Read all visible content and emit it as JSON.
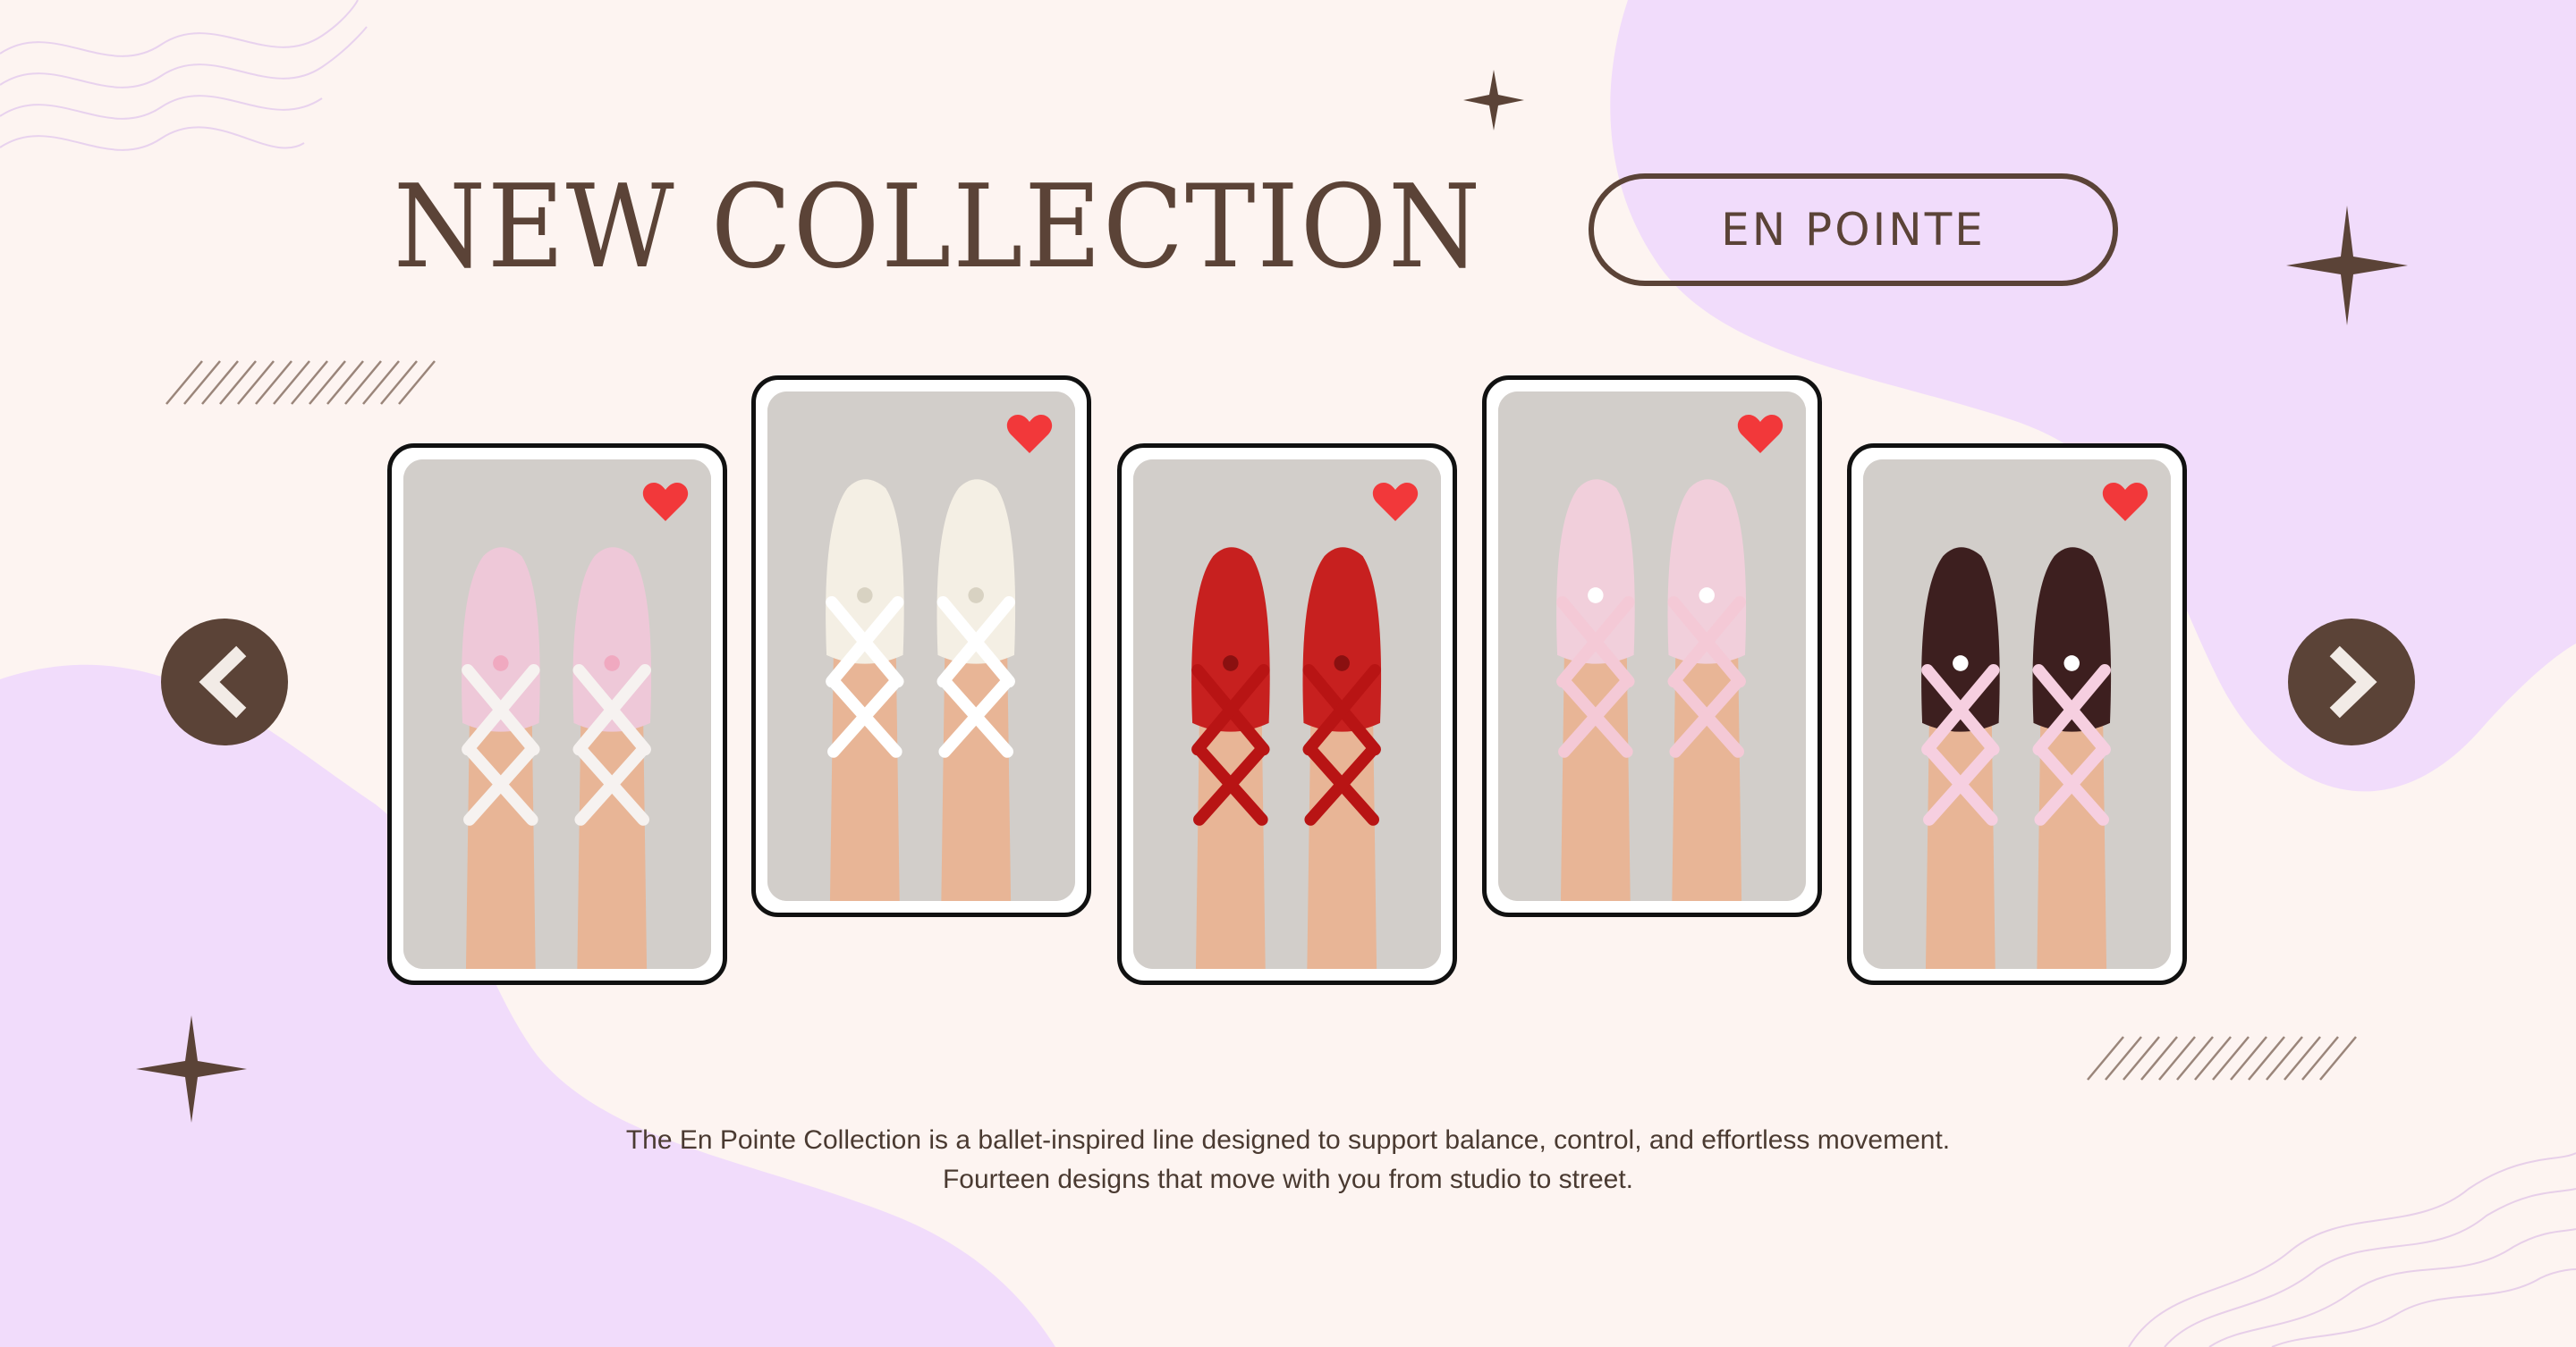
{
  "header": {
    "title": "NEW COLLECTION",
    "tag": "EN POINTE"
  },
  "carousel": {
    "prev_icon": "chevron-left-icon",
    "next_icon": "chevron-right-icon",
    "cards": [
      {
        "sock_color": "#eec8d8",
        "ribbon_color": "#f6f2f0",
        "bow_color": "#f0a9c0",
        "favorite_icon": "heart-icon"
      },
      {
        "sock_color": "#f4efe4",
        "ribbon_color": "#ffffff",
        "bow_color": "#d8d2c2",
        "favorite_icon": "heart-icon"
      },
      {
        "sock_color": "#c7201f",
        "ribbon_color": "#b81414",
        "bow_color": "#8a1010",
        "favorite_icon": "heart-icon"
      },
      {
        "sock_color": "#f1cfdb",
        "ribbon_color": "#f4c9d6",
        "bow_color": "#ffffff",
        "favorite_icon": "heart-icon"
      },
      {
        "sock_color": "#3d1f1f",
        "ribbon_color": "#f6cfe0",
        "bow_color": "#ffffff",
        "favorite_icon": "heart-icon"
      }
    ]
  },
  "caption": {
    "line1": "The En Pointe Collection is a ballet-inspired line designed to support balance, control, and effortless movement.",
    "line2": "Fourteen designs that move with you from studio to street."
  },
  "colors": {
    "background": "#fdf4f1",
    "lilac": "#f1dcfb",
    "brown": "#5b4337",
    "heart": "#f2383a"
  }
}
